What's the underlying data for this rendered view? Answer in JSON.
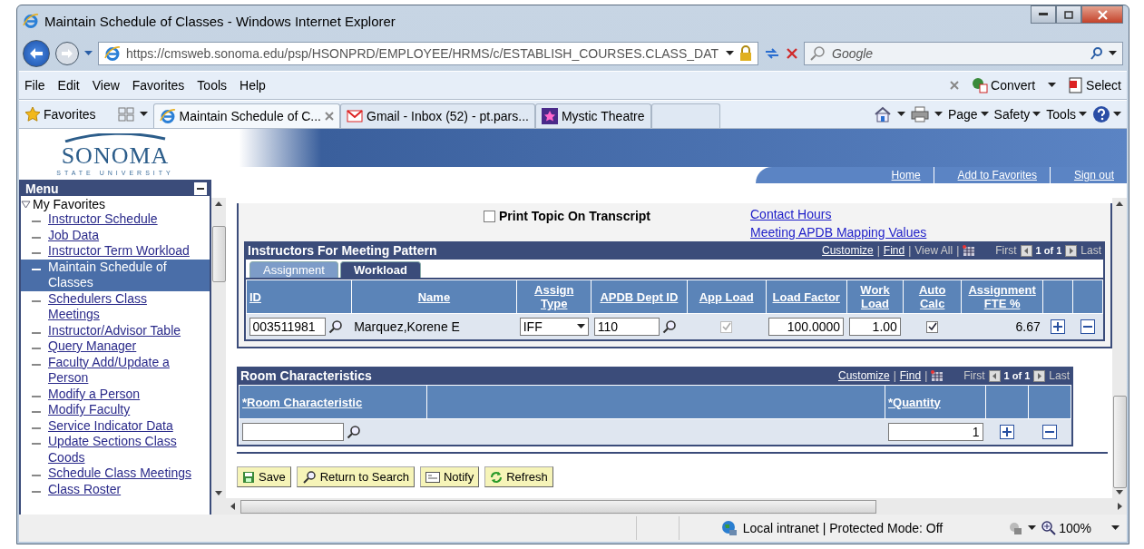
{
  "window": {
    "title": "Maintain Schedule of Classes - Windows Internet Explorer"
  },
  "address_bar": {
    "url": "https://cmsweb.sonoma.edu/psp/HSONPRD/EMPLOYEE/HRMS/c/ESTABLISH_COURSES.CLASS_DAT"
  },
  "search": {
    "placeholder": "Google"
  },
  "menu_bar": [
    "File",
    "Edit",
    "View",
    "Favorites",
    "Tools",
    "Help"
  ],
  "addon_toolbar": [
    "Convert",
    "Select"
  ],
  "favorites_label": "Favorites",
  "tabs": [
    {
      "label": "Maintain Schedule of C...",
      "selected": true
    },
    {
      "label": "Gmail - Inbox (52) - pt.pars...",
      "selected": false
    },
    {
      "label": "Mystic Theatre",
      "selected": false
    }
  ],
  "command_bar": [
    "Page",
    "Safety",
    "Tools"
  ],
  "site": {
    "logo": "SONOMA",
    "logo_subtitle": "STATE UNIVERSITY",
    "links": [
      "Home",
      "Add to Favorites",
      "Sign out"
    ]
  },
  "menu": {
    "title": "Menu",
    "tree": [
      {
        "label": "My Favorites",
        "expanded": true,
        "children": [
          {
            "label": "Instructor Schedule",
            "selected": false
          },
          {
            "label": "Job Data",
            "selected": false
          },
          {
            "label": "Instructor Term Workload",
            "selected": false
          },
          {
            "label": "Maintain Schedule of Classes",
            "selected": true
          },
          {
            "label": "Schedulers Class Meetings",
            "selected": false
          },
          {
            "label": "Instructor/Advisor Table",
            "selected": false
          },
          {
            "label": "Query Manager",
            "selected": false
          },
          {
            "label": "Faculty Add/Update a Person",
            "selected": false
          },
          {
            "label": "Modify a Person",
            "selected": false
          },
          {
            "label": "Modify Faculty",
            "selected": false
          },
          {
            "label": "Service Indicator Data",
            "selected": false
          },
          {
            "label": "Update Sections Class  Coods",
            "selected": false
          },
          {
            "label": "Schedule Class Meetings",
            "selected": false
          },
          {
            "label": "Class Roster",
            "selected": false
          }
        ]
      }
    ]
  },
  "print_topic": {
    "label": "Print Topic On Transcript",
    "checked": false
  },
  "links": [
    "Contact Hours",
    "Meeting APDB Mapping Values"
  ],
  "instructors": {
    "title": "Instructors For Meeting Pattern",
    "nav": {
      "customize": "Customize",
      "separator": "|",
      "find": "Find",
      "view_all": "View All",
      "first": "First",
      "count": "1 of 1",
      "last": "Last"
    },
    "tabs": [
      {
        "label": "Assignment",
        "selected": false
      },
      {
        "label": "Workload",
        "selected": true
      }
    ],
    "columns": [
      "ID",
      "Name",
      "Assign Type",
      "APDB Dept ID",
      "App Load",
      "Load Factor",
      "Work Load",
      "Auto Calc",
      "Assignment FTE %"
    ],
    "rows": [
      {
        "id": "003511981",
        "name": "Marquez,Korene E",
        "assign_type": "IFF",
        "apdb_dept_id": "110",
        "app_load": {
          "checked": true,
          "disabled": true
        },
        "load_factor": "100.0000",
        "work_load": "1.00",
        "auto_calc": {
          "checked": true,
          "disabled": false
        },
        "fte": "6.67"
      }
    ]
  },
  "room": {
    "title": "Room Characteristics",
    "nav": {
      "customize": "Customize",
      "separator": "|",
      "find": "Find",
      "first": "First",
      "count": "1 of 1",
      "last": "Last"
    },
    "columns": [
      "*Room Characteristic",
      "*Quantity"
    ],
    "rows": [
      {
        "quantity": "1"
      }
    ]
  },
  "buttons": [
    "Save",
    "Return to Search",
    "Notify",
    "Refresh"
  ],
  "status_bar": {
    "zone": "Local intranet | Protected Mode: Off",
    "zoom": "100%"
  }
}
